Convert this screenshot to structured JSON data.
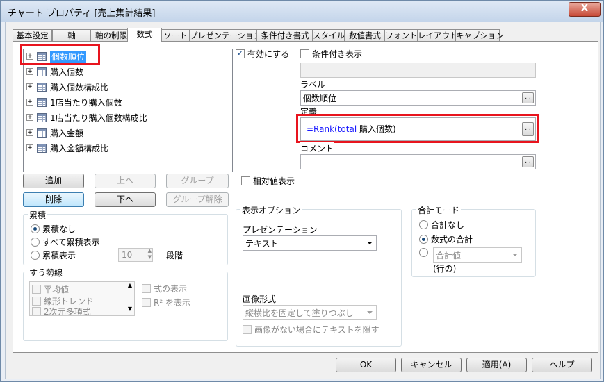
{
  "window": {
    "title": "チャート プロパティ [売上集計結果]",
    "close_glyph": "X"
  },
  "tabs": [
    "基本設定",
    "軸",
    "軸の制限",
    "数式",
    "ソート",
    "プレゼンテーション",
    "条件付き書式",
    "スタイル",
    "数値書式",
    "フォント",
    "レイアウト",
    "キャプション"
  ],
  "active_tab": "数式",
  "expressions": [
    {
      "label": "個数順位",
      "selected": true
    },
    {
      "label": "購入個数"
    },
    {
      "label": "購入個数構成比"
    },
    {
      "label": "1店当たり購入個数"
    },
    {
      "label": "1店当たり購入個数構成比"
    },
    {
      "label": "購入金額"
    },
    {
      "label": "購入金額構成比"
    }
  ],
  "tree_buttons": {
    "add": "追加",
    "up": "上へ",
    "group": "グループ",
    "delete": "削除",
    "down": "下へ",
    "ungroup": "グループ解除"
  },
  "accumulation": {
    "title": "累積",
    "options": [
      "累積なし",
      "すべて累積表示",
      "累積表示"
    ],
    "selected": "累積なし",
    "steps_value": "10",
    "steps_label": "段階"
  },
  "trendlines": {
    "title": "すう勢線",
    "items": [
      "平均値",
      "線形トレンド",
      "2次元多項式"
    ],
    "show_formula": "式の表示",
    "show_r2": "R² を表示"
  },
  "enable": {
    "label": "有効にする",
    "checked": true
  },
  "conditional": {
    "label": "条件付き表示",
    "checked": false
  },
  "label_field": {
    "caption": "ラベル",
    "value": "個数順位"
  },
  "definition": {
    "caption": "定義",
    "prefix": "=Rank(total ",
    "rest": "購入個数)",
    "accent_color": "#1a1aff"
  },
  "comment": {
    "caption": "コメント",
    "value": ""
  },
  "relative": {
    "label": "相対値表示"
  },
  "display_options": {
    "title": "表示オプション",
    "presentation_label": "プレゼンテーション",
    "presentation_value": "テキスト",
    "image_format_label": "画像形式",
    "image_format_value": "縦横比を固定して塗りつぶし",
    "hide_text_label": "画像がない場合にテキストを隠す"
  },
  "total_mode": {
    "title": "合計モード",
    "options": [
      "合計なし",
      "数式の合計"
    ],
    "selected": "数式の合計",
    "combo_value": "合計値",
    "rows_label": "(行の)"
  },
  "footer": {
    "ok": "OK",
    "cancel": "キャンセル",
    "apply": "適用(A)",
    "help": "ヘルプ"
  },
  "ellipsis_glyph": "...",
  "expand_glyph": "+",
  "check_glyph": "✓",
  "spin_up": "▲",
  "spin_down": "▼",
  "scroll_up": "▲",
  "scroll_down": "▼"
}
